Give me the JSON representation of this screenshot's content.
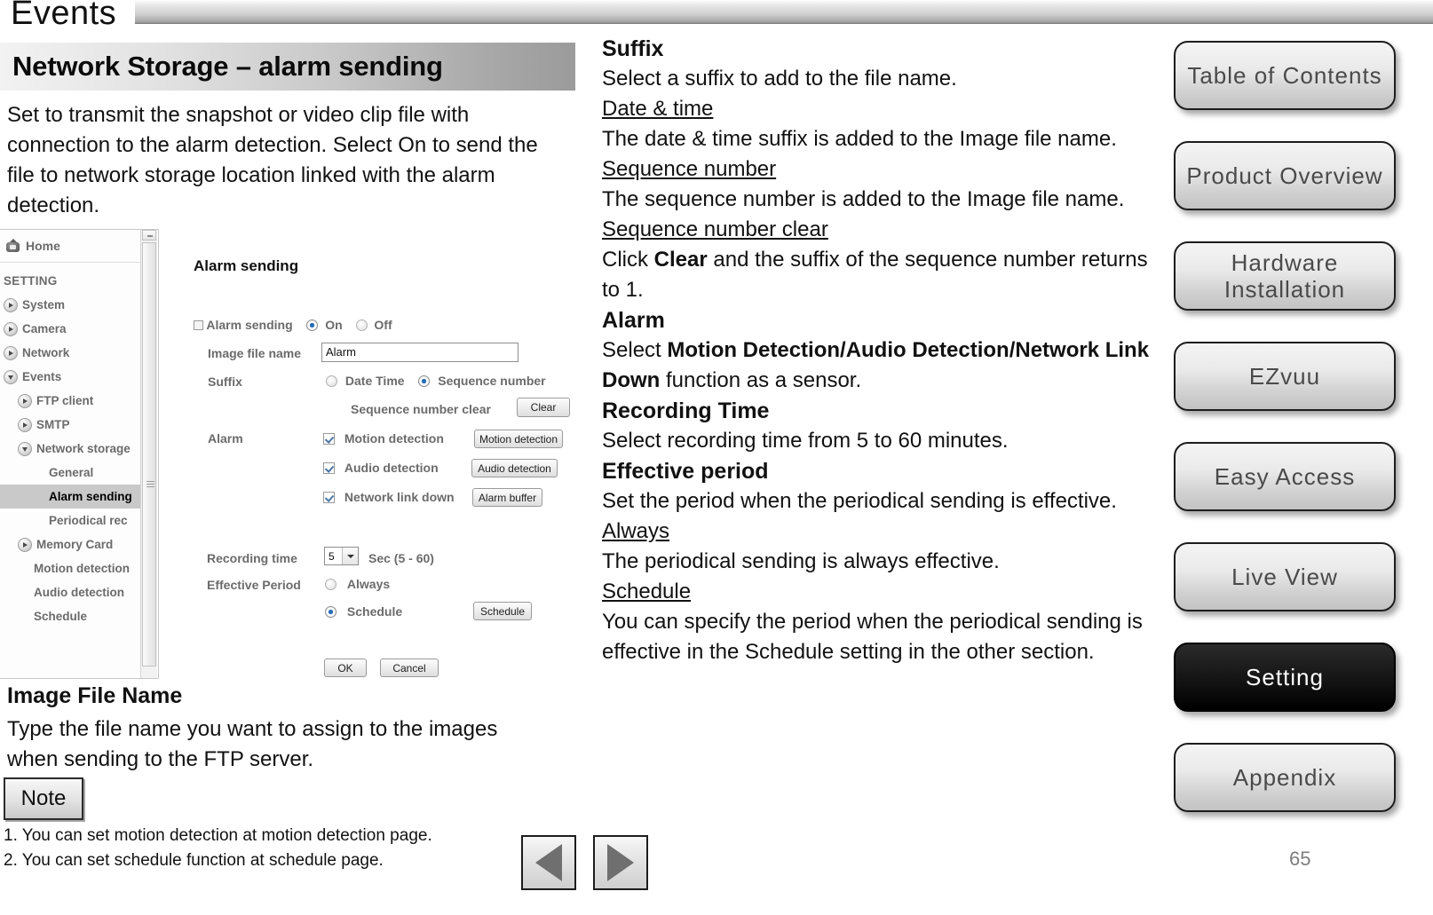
{
  "header": {
    "title": "Events"
  },
  "section": {
    "banner_title": "Network Storage – alarm sending",
    "intro": "Set to transmit the snapshot or video clip file with connection to the alarm detection. Select On to send the file to network storage location linked with the alarm detection."
  },
  "webui": {
    "home_label": "Home",
    "tree_heading": "SETTING",
    "tree": [
      {
        "label": "System",
        "level": 1,
        "arrow": "right",
        "selected": false
      },
      {
        "label": "Camera",
        "level": 1,
        "arrow": "right",
        "selected": false
      },
      {
        "label": "Network",
        "level": 1,
        "arrow": "right",
        "selected": false
      },
      {
        "label": "Events",
        "level": 1,
        "arrow": "down",
        "selected": false
      },
      {
        "label": "FTP client",
        "level": 2,
        "arrow": "right",
        "selected": false
      },
      {
        "label": "SMTP",
        "level": 2,
        "arrow": "right",
        "selected": false
      },
      {
        "label": "Network storage",
        "level": 2,
        "arrow": "down",
        "selected": false
      },
      {
        "label": "General",
        "level": 3,
        "arrow": "none",
        "selected": false
      },
      {
        "label": "Alarm sending",
        "level": 3,
        "arrow": "none",
        "selected": true
      },
      {
        "label": "Periodical rec",
        "level": 3,
        "arrow": "none",
        "selected": false
      },
      {
        "label": "Memory Card",
        "level": 2,
        "arrow": "right",
        "selected": false
      },
      {
        "label": "Motion detection",
        "level": 2,
        "arrow": "none",
        "selected": false
      },
      {
        "label": "Audio detection",
        "level": 2,
        "arrow": "none",
        "selected": false
      },
      {
        "label": "Schedule",
        "level": 2,
        "arrow": "none",
        "selected": false
      }
    ]
  },
  "form": {
    "title": "Alarm sending",
    "alarm_sending_label": "Alarm sending",
    "on_label": "On",
    "off_label": "Off",
    "alarm_sending_value": "On",
    "image_file_name_label": "Image file name",
    "image_file_name_value": "Alarm",
    "suffix_label": "Suffix",
    "suffix_date_time_label": "Date Time",
    "suffix_sequence_label": "Sequence number",
    "suffix_value": "Sequence number",
    "sequence_clear_label": "Sequence number clear",
    "clear_button": "Clear",
    "alarm_label": "Alarm",
    "motion_detection_label": "Motion detection",
    "motion_detection_button": "Motion detection",
    "motion_detection_checked": true,
    "audio_detection_label": "Audio detection",
    "audio_detection_button": "Audio detection",
    "audio_detection_checked": true,
    "network_link_down_label": "Network link down",
    "alarm_buffer_button": "Alarm buffer",
    "network_link_down_checked": true,
    "recording_time_label": "Recording time",
    "recording_time_value": "5",
    "recording_time_units": "Sec (5 - 60)",
    "effective_period_label": "Effective Period",
    "always_label": "Always",
    "schedule_label": "Schedule",
    "schedule_button": "Schedule",
    "effective_period_value": "Schedule",
    "ok_button": "OK",
    "cancel_button": "Cancel"
  },
  "left_doc": {
    "image_file_name_heading": "Image File Name",
    "image_file_name_body": "Type the file name you want to assign to the images when sending to the FTP server.",
    "note_badge": "Note",
    "note_1": "1. You can set motion detection at motion detection page.",
    "note_2": "2. You can set schedule function at schedule page."
  },
  "right_doc": {
    "suffix_heading": "Suffix",
    "suffix_body": "Select a suffix to add to the file name.",
    "date_time_term": "Date & time",
    "date_time_body": "The date & time suffix is added to the Image file name.",
    "sequence_number_term": "Sequence number",
    "sequence_number_body": "The sequence number is added to the Image file name.",
    "sequence_clear_term": "Sequence number clear",
    "sequence_clear_body_pre": "Click ",
    "sequence_clear_body_bold": "Clear",
    "sequence_clear_body_post": " and the suffix of the sequence number returns to 1.",
    "alarm_heading": "Alarm",
    "alarm_body_pre": "Select ",
    "alarm_body_bold": "Motion Detection/Audio Detection/Network Link Down",
    "alarm_body_post": "  function as a sensor.",
    "recording_time_heading": "Recording Time",
    "recording_time_body": "Select recording time from 5 to 60 minutes.",
    "effective_period_heading": "Effective period",
    "effective_period_body": "Set the period when the periodical sending is effective.",
    "always_term": "Always",
    "always_body": "The periodical sending is always effective.",
    "schedule_term": "Schedule",
    "schedule_body": "You can specify the period when the periodical sending is effective in the Schedule setting in the other section."
  },
  "nav": {
    "buttons": [
      {
        "label": "Table of Contents",
        "active": false
      },
      {
        "label": "Product Overview",
        "active": false
      },
      {
        "label": "Hardware Installation",
        "active": false
      },
      {
        "label": "EZvuu",
        "active": false
      },
      {
        "label": "Easy Access",
        "active": false
      },
      {
        "label": "Live View",
        "active": false
      },
      {
        "label": "Setting",
        "active": true
      },
      {
        "label": "Appendix",
        "active": false
      }
    ]
  },
  "footer": {
    "page_number": "65",
    "prev_label": "Previous page",
    "next_label": "Next page"
  },
  "colors": {
    "accent_selected_radio": "#2a6fb8",
    "tree_text": "#6b6b6b",
    "nav_button_text": "#4a4a4a",
    "active_nav_bg": "#000000"
  }
}
